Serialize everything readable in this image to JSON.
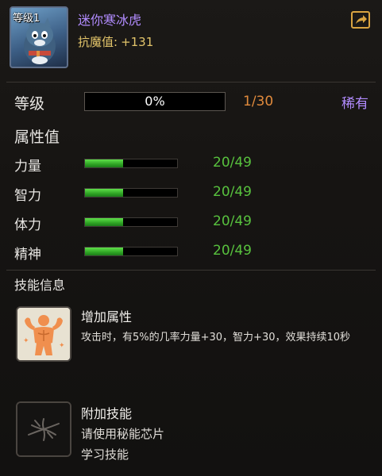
{
  "pet": {
    "level_tag": "等级1",
    "name": "迷你寒冰虎",
    "resist_label": "抗魔值:",
    "resist_value": "+131"
  },
  "level": {
    "label": "等级",
    "progress_text": "0%",
    "progress": 0,
    "count": "1/30",
    "rarity": "稀有"
  },
  "attributes": {
    "title": "属性值",
    "items": [
      {
        "label": "力量",
        "value": "20/49",
        "fill": 0.41
      },
      {
        "label": "智力",
        "value": "20/49",
        "fill": 0.41
      },
      {
        "label": "体力",
        "value": "20/49",
        "fill": 0.41
      },
      {
        "label": "精神",
        "value": "20/49",
        "fill": 0.41
      }
    ]
  },
  "skills": {
    "title": "技能信息",
    "primary": {
      "name": "增加属性",
      "desc": "攻击时，有5%的几率力量+30，智力+30，效果持续10秒",
      "icon": "muscle-icon"
    },
    "extra": {
      "name": "附加技能",
      "line1": "请使用秘能芯片",
      "line2": "学习技能",
      "icon": "locked-skill-icon"
    }
  },
  "colors": {
    "name": "#b28cff",
    "resist": "#e2c46a",
    "count": "#e08a3c",
    "bar_green": "#58c23e"
  }
}
